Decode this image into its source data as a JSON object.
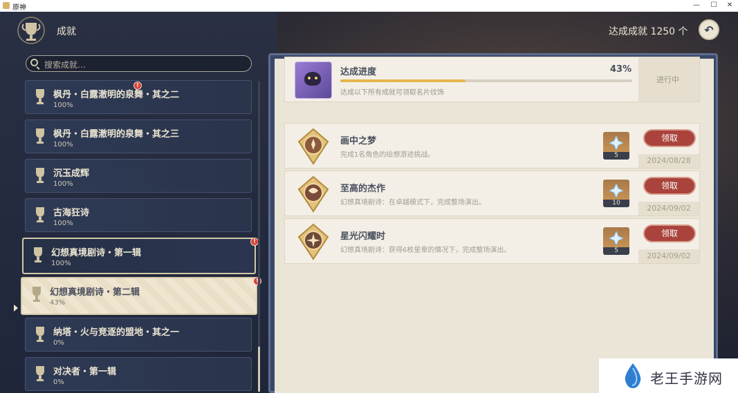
{
  "window": {
    "title": "原神",
    "min_glyph": "—",
    "max_glyph": "☐",
    "close_glyph": "✕"
  },
  "header": {
    "title": "成就",
    "total_label": "达成成就 1250 个",
    "back_glyph": "↶"
  },
  "search": {
    "placeholder": "搜索成就…"
  },
  "categories": [
    {
      "name": "枫丹・白露澈明的泉舞・其之二",
      "percent": "100%"
    },
    {
      "name": "枫丹・白露澈明的泉舞・其之三",
      "percent": "100%"
    },
    {
      "name": "沉玉成辉",
      "percent": "100%"
    },
    {
      "name": "古海狂诗",
      "percent": "100%"
    },
    {
      "name": "幻想真境剧诗・第一辑",
      "percent": "100%"
    },
    {
      "name": "幻想真境剧诗・第二辑",
      "percent": "43%"
    },
    {
      "name": "纳塔・火与竞逐的盟地・其之一",
      "percent": "0%"
    },
    {
      "name": "对决者・第一辑",
      "percent": "0%"
    }
  ],
  "alert_glyph": "!",
  "summary": {
    "title": "达成进度",
    "percent": "43%",
    "progress": 0.43,
    "description": "达成以下所有成就可领取名片纹饰",
    "status": "进行中"
  },
  "achievements": [
    {
      "name": "画中之梦",
      "description": "完成1名角色的绘想游迹挑战。",
      "reward_qty": "5",
      "claim_label": "领取",
      "date": "2024/08/28"
    },
    {
      "name": "至高的杰作",
      "description": "幻想真境剧诗：在卓越模式下，完成整场演出。",
      "reward_qty": "10",
      "claim_label": "领取",
      "date": "2024/09/02"
    },
    {
      "name": "星光闪耀时",
      "description": "幻想真境剧诗：获得6枚星章的情况下，完成整场演出。",
      "reward_qty": "5",
      "claim_label": "领取",
      "date": "2024/09/02"
    }
  ],
  "watermark": {
    "text": "老王手游网"
  },
  "colors": {
    "accent_gold": "#e4b64c",
    "claim_red": "#a9433b",
    "panel_bg": "#ebe5d8",
    "sidebar_bg": "#2a344b"
  }
}
